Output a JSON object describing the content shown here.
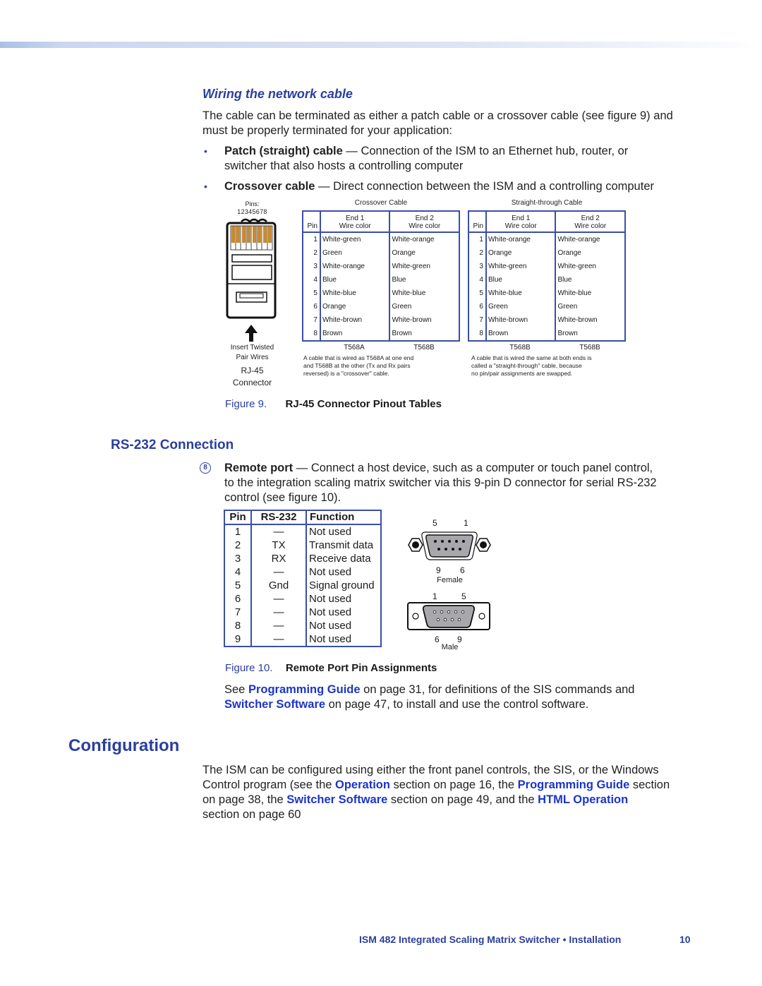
{
  "section_wiring": {
    "heading": "Wiring the network cable",
    "intro_line1": "The cable can be terminated as either a patch cable or a crossover cable (see figure 9) and",
    "intro_line2": "must be properly terminated for your application:",
    "bullets": [
      {
        "term": "Patch (straight) cable",
        "text_line1": " — Connection of the ISM to an Ethernet hub, router, or",
        "text_line2": "switcher that also hosts a controlling computer"
      },
      {
        "term": "Crossover cable",
        "text_line1": " — Direct connection between the ISM and a controlling computer"
      }
    ]
  },
  "figure9": {
    "connector": {
      "pins_label": "Pins:",
      "pins_numbers": "12345678",
      "insert_label_1": "Insert Twisted",
      "insert_label_2": "Pair Wires",
      "name_1": "RJ-45",
      "name_2": "Connector"
    },
    "crossover": {
      "title": "Crossover Cable",
      "headers": {
        "pin": "Pin",
        "end1_a": "End 1",
        "end1_b": "Wire color",
        "end2_a": "End 2",
        "end2_b": "Wire color"
      },
      "rows": [
        {
          "pin": "1",
          "end1": "White-green",
          "end2": "White-orange"
        },
        {
          "pin": "2",
          "end1": "Green",
          "end2": "Orange"
        },
        {
          "pin": "3",
          "end1": "White-orange",
          "end2": "White-green"
        },
        {
          "pin": "4",
          "end1": "Blue",
          "end2": "Blue"
        },
        {
          "pin": "5",
          "end1": "White-blue",
          "end2": "White-blue"
        },
        {
          "pin": "6",
          "end1": "Orange",
          "end2": "Green"
        },
        {
          "pin": "7",
          "end1": "White-brown",
          "end2": "White-brown"
        },
        {
          "pin": "8",
          "end1": "Brown",
          "end2": "Brown"
        }
      ],
      "std_end1": "T568A",
      "std_end2": "T568B",
      "note_1": "A cable that is wired as T568A at one end",
      "note_2": "and T568B at the other (Tx and Rx pairs",
      "note_3": "reversed) is a \"crossover\" cable."
    },
    "straight": {
      "title": "Straight-through Cable",
      "headers": {
        "pin": "Pin",
        "end1_a": "End 1",
        "end1_b": "Wire color",
        "end2_a": "End 2",
        "end2_b": "Wire color"
      },
      "rows": [
        {
          "pin": "1",
          "end1": "White-orange",
          "end2": "White-orange"
        },
        {
          "pin": "2",
          "end1": "Orange",
          "end2": "Orange"
        },
        {
          "pin": "3",
          "end1": "White-green",
          "end2": "White-green"
        },
        {
          "pin": "4",
          "end1": "Blue",
          "end2": "Blue"
        },
        {
          "pin": "5",
          "end1": "White-blue",
          "end2": "White-blue"
        },
        {
          "pin": "6",
          "end1": "Green",
          "end2": "Green"
        },
        {
          "pin": "7",
          "end1": "White-brown",
          "end2": "White-brown"
        },
        {
          "pin": "8",
          "end1": "Brown",
          "end2": "Brown"
        }
      ],
      "std_end1": "T568B",
      "std_end2": "T568B",
      "note_1": "A cable that is wired the same at both ends is",
      "note_2": "called a \"straight-through\" cable, because",
      "note_3": "no pin/pair assignments are swapped."
    },
    "caption_num": "Figure 9.",
    "caption_text": "RJ-45 Connector Pinout Tables"
  },
  "section_rs232": {
    "heading": "RS-232 Connection",
    "callout": "8",
    "term": "Remote port",
    "text_line1": " — Connect a host device, such as a computer or touch panel control,",
    "text_line2": "to the integration scaling matrix switcher via this 9-pin D connector for serial RS-232",
    "text_line3": "control (see figure 10).",
    "table": {
      "headers": [
        "Pin",
        "RS-232",
        "Function"
      ],
      "rows": [
        [
          "1",
          "—",
          "Not used"
        ],
        [
          "2",
          "TX",
          "Transmit data"
        ],
        [
          "3",
          "RX",
          "Receive data"
        ],
        [
          "4",
          "—",
          "Not used"
        ],
        [
          "5",
          "Gnd",
          "Signal ground"
        ],
        [
          "6",
          "—",
          "Not used"
        ],
        [
          "7",
          "—",
          "Not used"
        ],
        [
          "8",
          "—",
          "Not used"
        ],
        [
          "9",
          "—",
          "Not used"
        ]
      ]
    },
    "female": {
      "top_left": "5",
      "top_right": "1",
      "bottom_left": "9",
      "bottom_right": "6",
      "label": "Female"
    },
    "male": {
      "top_left": "1",
      "top_right": "5",
      "bottom_left": "6",
      "bottom_right": "9",
      "label": "Male"
    },
    "caption_num": "Figure 10.",
    "caption_text": "Remote Port Pin Assignments",
    "see_1a": "See ",
    "see_link1": "Programming Guide",
    "see_1b": " on page 31, for definitions of the SIS commands and",
    "see_link2": "Switcher Software",
    "see_2b": " on page 47, to install and use the control software."
  },
  "section_config": {
    "heading": "Configuration",
    "l1": "The ISM can be configured using either the front panel controls, the SIS, or the Windows",
    "l2a": "Control program (see the ",
    "l2_link1": "Operation",
    "l2b": " section on page 16, the ",
    "l2_link2": "Programming Guide",
    "l2c": " section",
    "l3a": "on page 38, the ",
    "l3_link1": "Switcher Software",
    "l3b": " section on page 49, and the ",
    "l3_link2": "HTML Operation",
    "l4": "section on page 60"
  },
  "footer": {
    "title": "ISM 482 Integrated Scaling Matrix Switcher • Installation",
    "page": "10"
  }
}
